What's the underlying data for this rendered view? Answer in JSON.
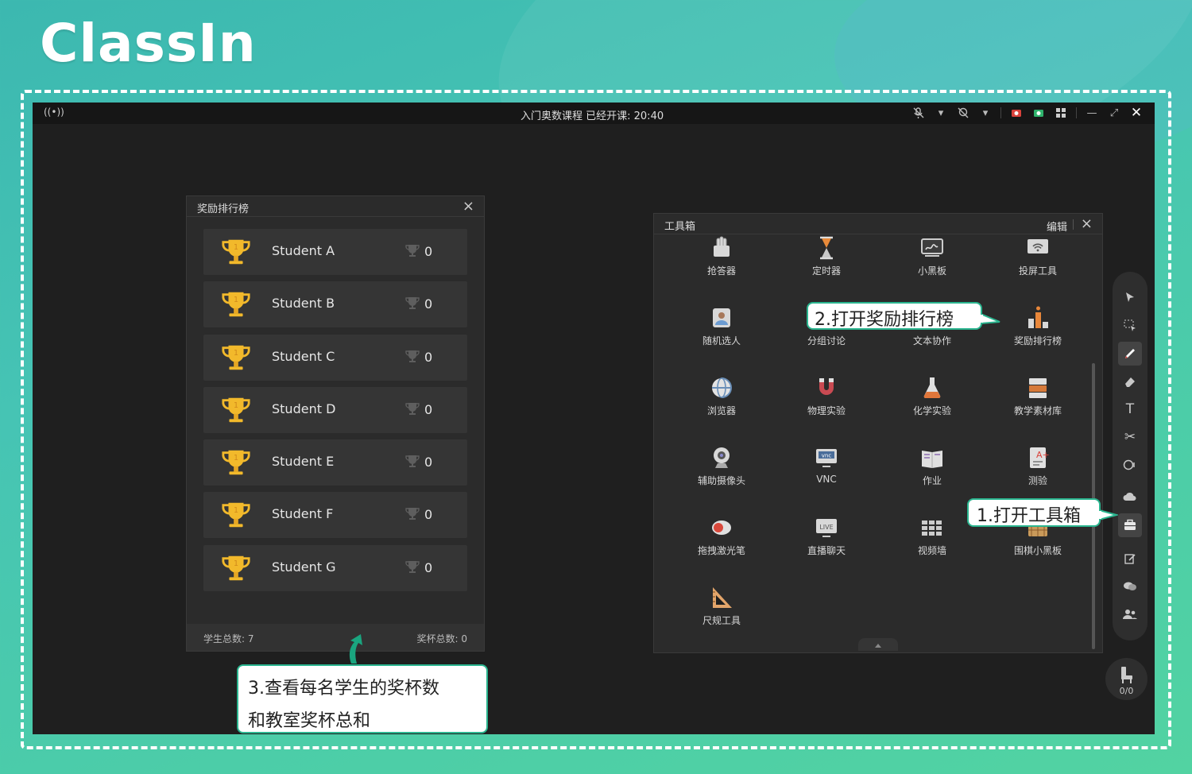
{
  "brand": {
    "logo_text": "ClassIn"
  },
  "titlebar": {
    "title": "入门奥数课程   已经开课: 20:40",
    "signal_label": "((•))"
  },
  "leaderboard": {
    "title": "奖励排行榜",
    "students": [
      {
        "name": "Student A",
        "cups": "0"
      },
      {
        "name": "Student B",
        "cups": "0"
      },
      {
        "name": "Student C",
        "cups": "0"
      },
      {
        "name": "Student D",
        "cups": "0"
      },
      {
        "name": "Student E",
        "cups": "0"
      },
      {
        "name": "Student F",
        "cups": "0"
      },
      {
        "name": "Student G",
        "cups": "0"
      }
    ],
    "footer_students": "学生总数: 7",
    "footer_cups": "奖杯总数: 0"
  },
  "toolbox": {
    "title": "工具箱",
    "edit_label": "编辑",
    "tools": [
      {
        "label": "抢答器",
        "icon": "buzzer-icon"
      },
      {
        "label": "定时器",
        "icon": "hourglass-icon"
      },
      {
        "label": "小黑板",
        "icon": "blackboard-icon"
      },
      {
        "label": "投屏工具",
        "icon": "screen-cast-icon"
      },
      {
        "label": "随机选人",
        "icon": "random-pick-icon"
      },
      {
        "label": "分组讨论",
        "icon": "group-discussion-icon"
      },
      {
        "label": "文本协作",
        "icon": "text-collab-icon"
      },
      {
        "label": "奖励排行榜",
        "icon": "leaderboard-icon"
      },
      {
        "label": "浏览器",
        "icon": "browser-icon"
      },
      {
        "label": "物理实验",
        "icon": "magnet-icon"
      },
      {
        "label": "化学实验",
        "icon": "flask-icon"
      },
      {
        "label": "教学素材库",
        "icon": "materials-icon"
      },
      {
        "label": "辅助摄像头",
        "icon": "webcam-icon"
      },
      {
        "label": "VNC",
        "icon": "vnc-icon"
      },
      {
        "label": "作业",
        "icon": "homework-icon"
      },
      {
        "label": "测验",
        "icon": "quiz-icon"
      },
      {
        "label": "拖拽激光笔",
        "icon": "laser-pointer-icon"
      },
      {
        "label": "直播聊天",
        "icon": "live-chat-icon"
      },
      {
        "label": "视频墙",
        "icon": "video-wall-icon"
      },
      {
        "label": "围棋小黑板",
        "icon": "go-board-icon"
      },
      {
        "label": "尺规工具",
        "icon": "ruler-icon"
      }
    ]
  },
  "sidebar": {
    "seat_count": "0/0"
  },
  "callouts": {
    "step1": "1.打开工具箱",
    "step2": "2.打开奖励排行榜",
    "step3_line1": "3.查看每名学生的奖杯数",
    "step3_line2": "和教室奖杯总和"
  },
  "colors": {
    "background_teal": "#46c4b4",
    "window_dark": "#1f1f1f",
    "panel": "#2b2b2b",
    "trophy_gold": "#f2b92b",
    "callout_border": "#2ab58f"
  }
}
